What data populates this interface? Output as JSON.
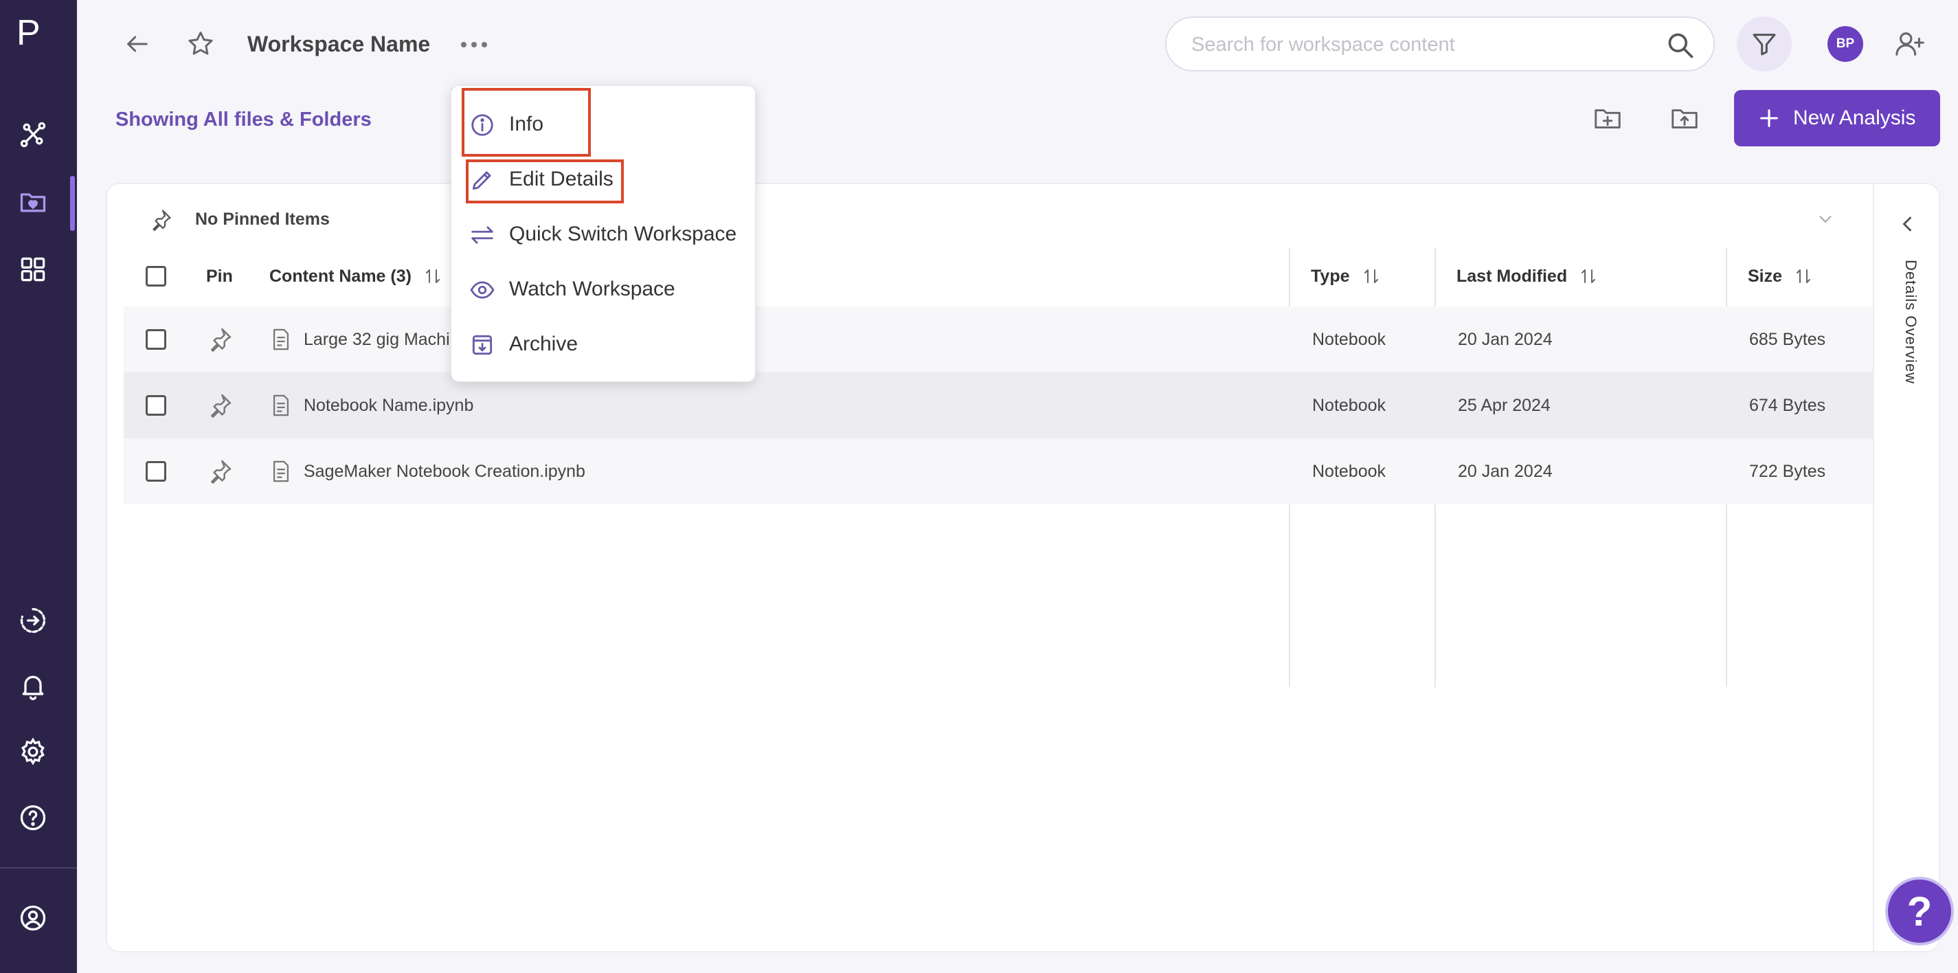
{
  "sidebar": {
    "logo": "P"
  },
  "header": {
    "workspace_title": "Workspace Name",
    "search_placeholder": "Search for workspace content",
    "avatar_initials": "BP"
  },
  "subheader": {
    "showing_label": "Showing All files & Folders",
    "new_analysis_label": "New Analysis"
  },
  "pinned": {
    "label": "No Pinned Items"
  },
  "table": {
    "columns": {
      "pin": "Pin",
      "content_name": "Content Name (3)",
      "type": "Type",
      "last_modified": "Last Modified",
      "size": "Size"
    },
    "rows": [
      {
        "name": "Large 32 gig Machi",
        "type": "Notebook",
        "modified": "20 Jan 2024",
        "size": "685 Bytes"
      },
      {
        "name": "Notebook Name.ipynb",
        "type": "Notebook",
        "modified": "25 Apr 2024",
        "size": "674 Bytes"
      },
      {
        "name": "SageMaker Notebook Creation.ipynb",
        "type": "Notebook",
        "modified": "20 Jan 2024",
        "size": "722 Bytes"
      }
    ]
  },
  "details_panel": {
    "label": "Details Overview"
  },
  "menu": {
    "items": [
      {
        "label": "Info",
        "icon": "info-icon"
      },
      {
        "label": "Edit Details",
        "icon": "pencil-icon"
      },
      {
        "label": "Quick Switch Workspace",
        "icon": "swap-arrows-icon"
      },
      {
        "label": "Watch Workspace",
        "icon": "eye-icon"
      },
      {
        "label": "Archive",
        "icon": "archive-icon"
      }
    ]
  },
  "help": {
    "label": "?"
  },
  "colors": {
    "sidebar": "#2c2448",
    "accent": "#6a3fc0",
    "highlight": "#d9472b"
  }
}
